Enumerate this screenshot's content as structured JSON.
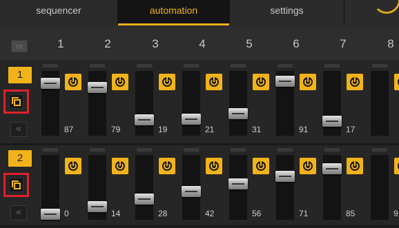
{
  "tabs": [
    "sequencer",
    "automation",
    "settings"
  ],
  "active_tab": 1,
  "mute_label": "m",
  "columns": [
    "1",
    "2",
    "3",
    "4",
    "5",
    "6",
    "7",
    "8"
  ],
  "tracks": [
    {
      "label": "1",
      "values": [
        87,
        79,
        19,
        21,
        31,
        91,
        17,
        null
      ],
      "value_labels": [
        "87",
        "79",
        "19",
        "21",
        "31",
        "91",
        "17",
        ""
      ]
    },
    {
      "label": "2",
      "values": [
        0,
        14,
        28,
        42,
        56,
        71,
        85,
        null
      ],
      "value_labels": [
        "0",
        "14",
        "28",
        "42",
        "56",
        "71",
        "85",
        "9"
      ]
    }
  ],
  "rewind_glyph": "«",
  "colors": {
    "accent": "#f2b31a",
    "highlight_box": "#e2202b"
  }
}
